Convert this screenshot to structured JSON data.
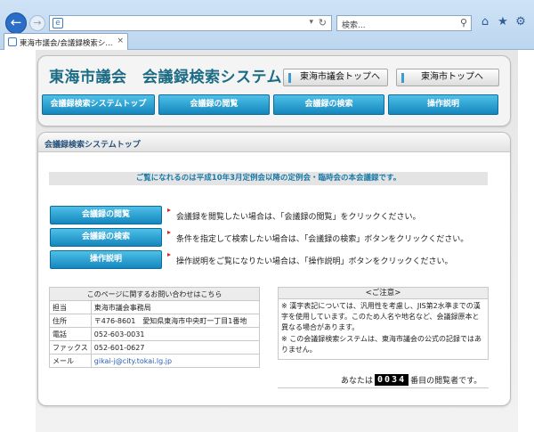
{
  "browser": {
    "address_value": "",
    "search_placeholder": "検索...",
    "tab_title": "東海市議会/会議録検索シ...",
    "tab_close": "×",
    "icons": [
      "back-arrow-icon",
      "forward-arrow-icon",
      "page-icon",
      "dropdown-icon",
      "refresh-icon",
      "search-icon",
      "home-icon",
      "favorites-star-icon",
      "settings-gear-icon"
    ]
  },
  "header": {
    "site_title": "東海市議会　会議録検索システム",
    "link_council_top": "東海市議会トップへ",
    "link_city_top": "東海市トップへ"
  },
  "nav": [
    {
      "label": "会議録検索システムトップ"
    },
    {
      "label": "会議録の閲覧"
    },
    {
      "label": "会議録の検索"
    },
    {
      "label": "操作説明"
    }
  ],
  "section": {
    "title": "会議録検索システムトップ",
    "notice": "ご覧になれるのは平成10年3月定例会以降の定例会・臨時会の本会議録です。"
  },
  "actions": [
    {
      "label": "会議録の閲覧",
      "description": "会議録を閲覧したい場合は、「会議録の閲覧」をクリックください。"
    },
    {
      "label": "会議録の検索",
      "description": "条件を指定して検索したい場合は、「会議録の検索」ボタンをクリックください。"
    },
    {
      "label": "操作説明",
      "description": "操作説明をご覧になりたい場合は、「操作説明」ボタンをクリックください。"
    }
  ],
  "contact": {
    "heading": "このページに関するお問い合わせはこちら",
    "rows": [
      {
        "key": "担当",
        "value": "東海市議会事務局"
      },
      {
        "key": "住所",
        "value": "〒476-8601　愛知県東海市中央町一丁目1番地"
      },
      {
        "key": "電話",
        "value": "052-603-0031"
      },
      {
        "key": "ファックス",
        "value": "052-601-0627"
      },
      {
        "key": "メール",
        "value": "gikai-j@city.tokai.lg.jp"
      }
    ]
  },
  "caution": {
    "heading": "<ご注意>",
    "line1": "※ 漢字表記については、汎用性を考慮し、JIS第2水準までの漢字を使用しています。このため人名や地名など、会議録原本と異なる場合があります。",
    "line2": "※ この会議録検索システムは、東海市議会の公式の記録ではありません。"
  },
  "counter": {
    "prefix": "あなたは",
    "digits": "0034",
    "suffix": "番目の閲覧者です。"
  },
  "colors": {
    "title": "#1b6b85",
    "button_top": "#4ec0e8",
    "button_bottom": "#1486bd",
    "notice_text": "#1a7aa8",
    "bullet": "#dd2222"
  }
}
